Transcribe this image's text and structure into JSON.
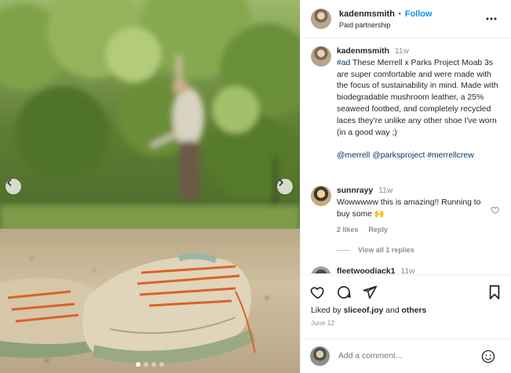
{
  "post": {
    "username": "kadenmsmith",
    "follow_label": "Follow",
    "sponsor_label": "Paid partnership",
    "separator": "•"
  },
  "caption": {
    "username": "kadenmsmith",
    "time": "11w",
    "hashtag": "#ad",
    "text": " These Merrell x Parks Project Moab 3s are super comfortable and were made with the focus of sustainability in mind. Made with biodegradable mushroom leather, a 25% seaweed footbed, and completely recycled laces they're unlike any other shoe I've worn (in a good way ;)",
    "tags": [
      "@merrell",
      "@parksproject",
      "#merrellcrew"
    ]
  },
  "comments": [
    {
      "username": "sunnrayy",
      "time": "11w",
      "text": "Wowwwww this is amazing!! Running to buy some 🙌",
      "likes": "2 likes",
      "reply_label": "Reply",
      "view_replies": "View all 1 replies"
    },
    {
      "username": "fleetwoodiack1",
      "time": "11w"
    }
  ],
  "likes": {
    "prefix": "Liked by ",
    "user": "sliceof.joy",
    "middle": " and ",
    "others": "others"
  },
  "date": "June 12",
  "add_comment": {
    "placeholder": "Add a comment..."
  },
  "icons": {
    "like": "heart-icon",
    "comment": "comment-icon",
    "share": "paper-plane-icon",
    "save": "bookmark-icon",
    "more": "more-horizontal-icon",
    "emoji": "emoji-icon",
    "prev": "chevron-left-icon",
    "next": "chevron-right-icon"
  },
  "carousel": {
    "slide_count": 4,
    "active_index": 0
  },
  "colors": {
    "link": "#0095f6",
    "hashtag": "#00376b",
    "muted": "#8e8e8e"
  }
}
